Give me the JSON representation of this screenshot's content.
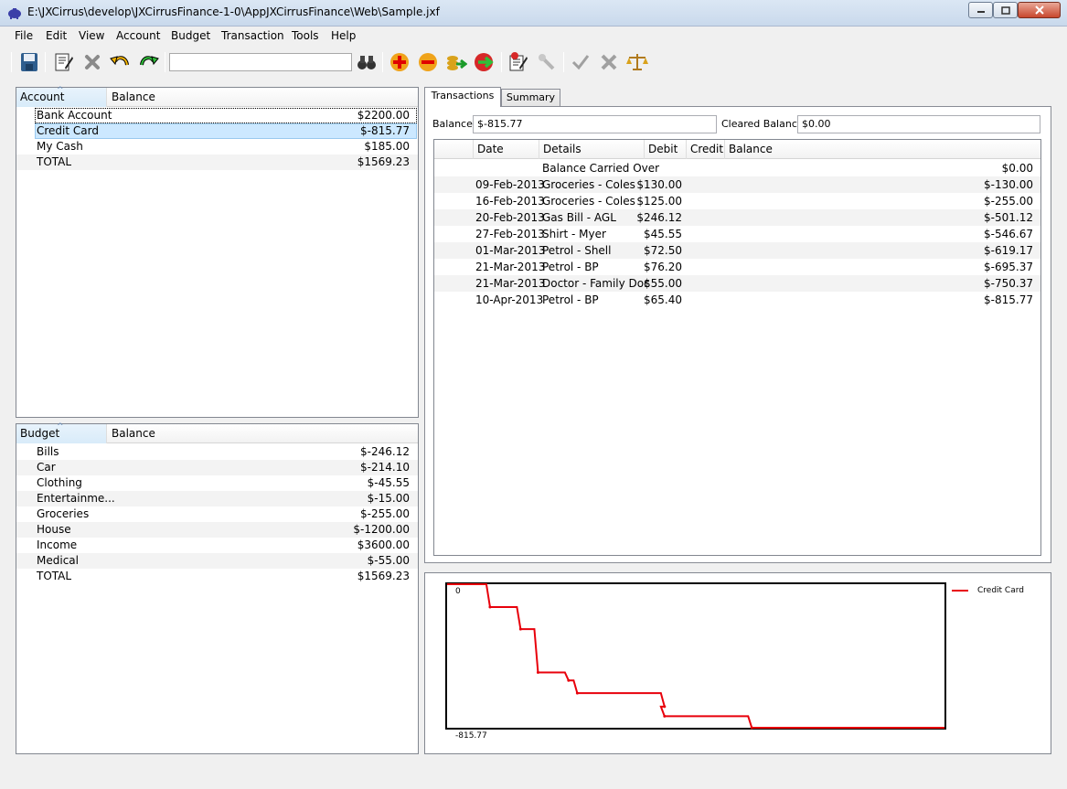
{
  "window": {
    "title": "E:\\JXCirrus\\develop\\JXCirrusFinance-1-0\\AppJXCirrusFinance\\Web\\Sample.jxf",
    "icon": "piggy-bank-icon"
  },
  "menu": [
    "File",
    "Edit",
    "View",
    "Account",
    "Budget",
    "Transaction",
    "Tools",
    "Help"
  ],
  "toolbar": {
    "search_value": "",
    "buttons": [
      "save-icon",
      "edit-icon",
      "delete-icon",
      "undo-icon",
      "redo-icon",
      "find-icon",
      "add-account-icon",
      "remove-account-icon",
      "transfer-icon",
      "move-icon",
      "edit-transaction-icon",
      "tools-icon",
      "approve-icon",
      "reject-icon",
      "reconcile-icon"
    ]
  },
  "accounts": {
    "headers": {
      "name": "Account",
      "balance": "Balance"
    },
    "rows": [
      {
        "name": "Bank Account",
        "balance": "$2200.00"
      },
      {
        "name": "Credit Card",
        "balance": "$-815.77"
      },
      {
        "name": "My Cash",
        "balance": "$185.00"
      },
      {
        "name": "TOTAL",
        "balance": "$1569.23"
      }
    ]
  },
  "budgets": {
    "headers": {
      "name": "Budget",
      "balance": "Balance"
    },
    "rows": [
      {
        "name": "Bills",
        "balance": "$-246.12"
      },
      {
        "name": "Car",
        "balance": "$-214.10"
      },
      {
        "name": "Clothing",
        "balance": "$-45.55"
      },
      {
        "name": "Entertainme...",
        "balance": "$-15.00"
      },
      {
        "name": "Groceries",
        "balance": "$-255.00"
      },
      {
        "name": "House",
        "balance": "$-1200.00"
      },
      {
        "name": "Income",
        "balance": "$3600.00"
      },
      {
        "name": "Medical",
        "balance": "$-55.00"
      },
      {
        "name": "TOTAL",
        "balance": "$1569.23"
      }
    ]
  },
  "tabs": [
    {
      "label": "Transactions",
      "active": true
    },
    {
      "label": "Summary",
      "active": false
    }
  ],
  "transactions_panel": {
    "balance_label": "Balance",
    "balance_value": "$-815.77",
    "cleared_label": "Cleared Balance",
    "cleared_value": "$0.00",
    "headers": {
      "date": "Date",
      "details": "Details",
      "debit": "Debit",
      "credit": "Credit",
      "balance": "Balance"
    },
    "rows": [
      {
        "date": "",
        "details": "Balance Carried Over",
        "debit": "",
        "credit": "",
        "balance": "$0.00"
      },
      {
        "date": "09-Feb-2013",
        "details": "Groceries - Coles",
        "debit": "$130.00",
        "credit": "",
        "balance": "$-130.00"
      },
      {
        "date": "16-Feb-2013",
        "details": "Groceries - Coles",
        "debit": "$125.00",
        "credit": "",
        "balance": "$-255.00"
      },
      {
        "date": "20-Feb-2013",
        "details": "Gas Bill - AGL",
        "debit": "$246.12",
        "credit": "",
        "balance": "$-501.12"
      },
      {
        "date": "27-Feb-2013",
        "details": "Shirt - Myer",
        "debit": "$45.55",
        "credit": "",
        "balance": "$-546.67"
      },
      {
        "date": "01-Mar-2013",
        "details": "Petrol - Shell",
        "debit": "$72.50",
        "credit": "",
        "balance": "$-619.17"
      },
      {
        "date": "21-Mar-2013",
        "details": "Petrol - BP",
        "debit": "$76.20",
        "credit": "",
        "balance": "$-695.37"
      },
      {
        "date": "21-Mar-2013",
        "details": "Doctor - Family Doc",
        "debit": "$55.00",
        "credit": "",
        "balance": "$-750.37"
      },
      {
        "date": "10-Apr-2013",
        "details": "Petrol - BP",
        "debit": "$65.40",
        "credit": "",
        "balance": "$-815.77"
      }
    ]
  },
  "chart_data": {
    "type": "line",
    "title": "",
    "xlabel": "",
    "ylabel": "",
    "ytop_label": "0",
    "ybottom_label": "-815.77",
    "ylim": [
      -815.77,
      0
    ],
    "xlim": [
      "2013-01-31",
      "2013-05-25"
    ],
    "grid": false,
    "legend_position": "right",
    "series": [
      {
        "name": "Credit Card",
        "color": "#e8000b",
        "step": true,
        "x": [
          "2013-02-09",
          "2013-02-16",
          "2013-02-20",
          "2013-02-27",
          "2013-03-01",
          "2013-03-21",
          "2013-03-21",
          "2013-04-10"
        ],
        "y": [
          -130.0,
          -255.0,
          -501.12,
          -546.67,
          -619.17,
          -695.37,
          -750.37,
          -815.77
        ]
      }
    ]
  }
}
